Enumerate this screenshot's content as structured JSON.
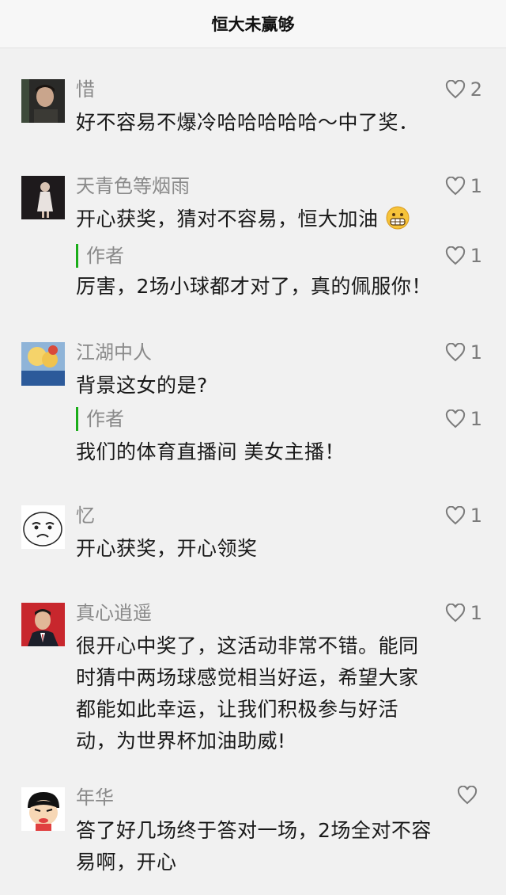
{
  "header": {
    "title": "恒大未赢够"
  },
  "comments": [
    {
      "name": "惜",
      "likes": "2",
      "lines": [
        "好不容易不爆冷哈哈哈哈哈～中了奖．"
      ]
    },
    {
      "name": "天青色等烟雨",
      "likes": "1",
      "lines": [
        "开心获奖，猜对不容易，恒大加油"
      ],
      "reply": {
        "label": "作者",
        "likes": "1",
        "text": "厉害，2场小球都才对了，真的佩服你！"
      }
    },
    {
      "name": "江湖中人",
      "likes": "1",
      "lines": [
        "背景这女的是?"
      ],
      "reply": {
        "label": "作者",
        "likes": "1",
        "text": "我们的体育直播间 美女主播！"
      }
    },
    {
      "name": "忆",
      "likes": "1",
      "lines": [
        "开心获奖，开心领奖"
      ]
    },
    {
      "name": "真心逍遥",
      "likes": "1",
      "lines": [
        "很开心中奖了，这活动非常不错。能同",
        "时猜中两场球感觉相当好运，希望大家",
        "都能如此幸运，让我们积极参与好活",
        "动，为世界杯加油助威!"
      ]
    },
    {
      "name": "年华",
      "likes": "",
      "lines": [
        "答了好几场终于答对一场，2场全对不容",
        "易啊，开心"
      ]
    }
  ],
  "icons": {
    "like": "heart-outline-icon",
    "emoji": "grinning-face-icon"
  },
  "colors": {
    "author_bar": "#1aad19",
    "name": "#8a8a8a",
    "background": "#f1f1f1"
  }
}
